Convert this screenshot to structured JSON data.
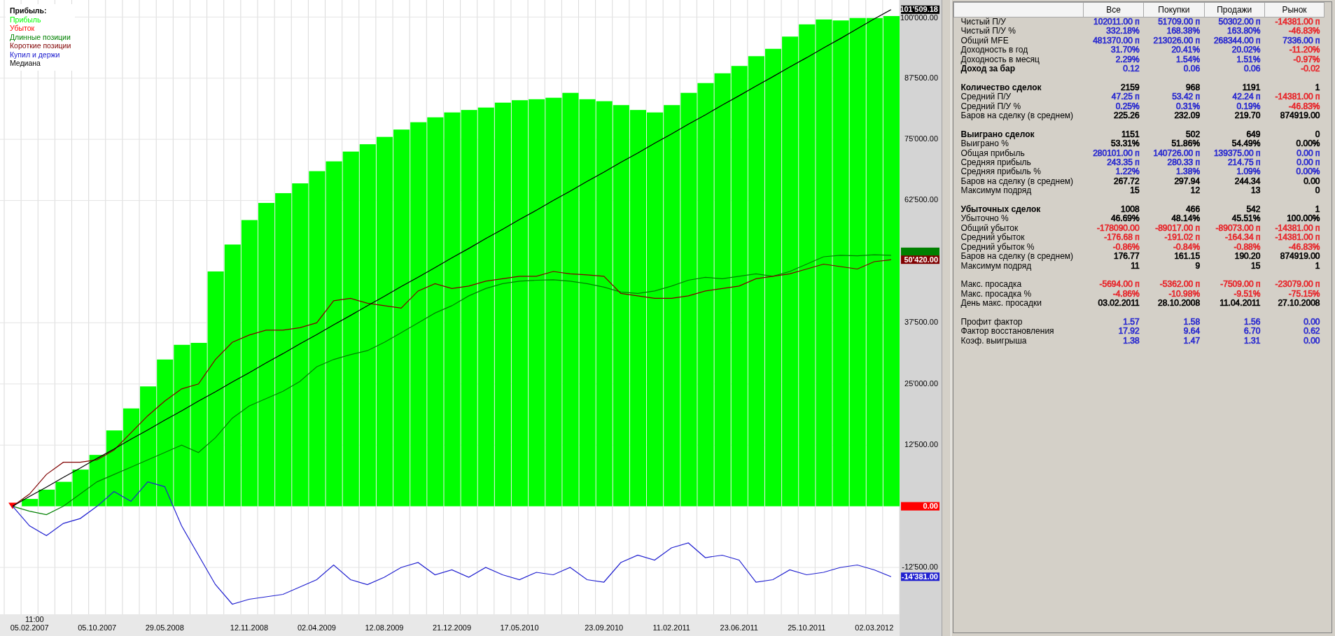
{
  "chart": {
    "time_label": "11:00",
    "chart_data": {
      "type": "bar",
      "title": "Прибыль:",
      "ylim": [
        -22080,
        103480
      ],
      "yticks": [
        {
          "value": -12500,
          "label": "-12'500.00"
        },
        {
          "value": 12500,
          "label": "12'500.00"
        },
        {
          "value": 25000,
          "label": "25'000.00"
        },
        {
          "value": 37500,
          "label": "37'500.00"
        },
        {
          "value": 62500,
          "label": "62'500.00"
        },
        {
          "value": 75000,
          "label": "75'000.00"
        },
        {
          "value": 87500,
          "label": "87'500.00"
        },
        {
          "value": 100000,
          "label": "100'000.00"
        }
      ],
      "grid": true,
      "categories": [
        null,
        "05.02.2007",
        null,
        null,
        null,
        "05.10.2007",
        null,
        null,
        null,
        "29.05.2008",
        null,
        null,
        null,
        null,
        "12.11.2008",
        null,
        null,
        null,
        "02.04.2009",
        null,
        null,
        null,
        "12.08.2009",
        null,
        null,
        null,
        "21.12.2009",
        null,
        null,
        null,
        "17.05.2010",
        null,
        null,
        null,
        null,
        "23.09.2010",
        null,
        null,
        null,
        "11.02.2011",
        null,
        null,
        null,
        "23.06.2011",
        null,
        null,
        null,
        "25.10.2011",
        null,
        null,
        null,
        "02.03.2012",
        null
      ],
      "series": [
        {
          "name": "Прибыль",
          "type": "bar",
          "color": "#00ff00",
          "values": [
            0,
            1500,
            3400,
            5000,
            7500,
            10500,
            15500,
            20000,
            24500,
            30000,
            33000,
            33400,
            48000,
            53500,
            58500,
            62000,
            64000,
            66000,
            68500,
            70500,
            72500,
            74000,
            75500,
            77000,
            78500,
            79500,
            80500,
            81000,
            81500,
            82500,
            83000,
            83200,
            83500,
            84500,
            83200,
            82800,
            82000,
            81000,
            80500,
            82000,
            84500,
            86500,
            88500,
            90000,
            92000,
            93500,
            96000,
            98500,
            99500,
            99300,
            99800,
            99800,
            100200
          ]
        },
        {
          "name": "Убыток",
          "type": "line",
          "color": "#ff0000",
          "marker": "triangle",
          "values": [
            0,
            null,
            null,
            null,
            null,
            null,
            null,
            null,
            null,
            null,
            null,
            null,
            null,
            null,
            null,
            null,
            null,
            null,
            null,
            null,
            null,
            null,
            null,
            null,
            null,
            null,
            null,
            null,
            null,
            null,
            null,
            null,
            null,
            null,
            null,
            null,
            null,
            null,
            null,
            null,
            null,
            null,
            null,
            null,
            null,
            null,
            null,
            null,
            null,
            null,
            null,
            null,
            null
          ]
        },
        {
          "name": "Длинные позиции",
          "type": "line",
          "color": "#008000",
          "values": [
            0,
            -1000,
            -1700,
            0,
            2500,
            5000,
            6500,
            8000,
            9500,
            11000,
            12500,
            11000,
            14000,
            18000,
            20500,
            22000,
            23500,
            25500,
            28500,
            30000,
            31000,
            31800,
            33500,
            35500,
            37500,
            39500,
            41000,
            43000,
            44500,
            45500,
            46000,
            46200,
            46300,
            46000,
            45500,
            44800,
            43800,
            43500,
            44000,
            45000,
            46200,
            46800,
            46500,
            47000,
            47500,
            47000,
            48000,
            49500,
            51000,
            51300,
            51200,
            51400,
            51300
          ]
        },
        {
          "name": "Короткие позиции",
          "type": "line",
          "color": "#800000",
          "values": [
            0,
            2500,
            6500,
            9000,
            9000,
            9500,
            11500,
            15000,
            18500,
            21500,
            24000,
            25000,
            30000,
            33500,
            35000,
            36000,
            36000,
            36500,
            37500,
            42000,
            42500,
            41500,
            41000,
            40500,
            44000,
            45500,
            44500,
            45000,
            46000,
            46500,
            47000,
            47000,
            48000,
            47500,
            47300,
            47000,
            43500,
            43000,
            42500,
            42500,
            43000,
            44000,
            44500,
            45000,
            46500,
            47000,
            47500,
            48500,
            49500,
            49000,
            48500,
            50000,
            50400
          ]
        },
        {
          "name": "Купил и держи",
          "type": "line",
          "color": "#2020d0",
          "values": [
            0,
            -4000,
            -6000,
            -3500,
            -2500,
            0,
            3000,
            1000,
            5000,
            4000,
            -4000,
            -10000,
            -16000,
            -20000,
            -19000,
            -18500,
            -18000,
            -16500,
            -15000,
            -12000,
            -15000,
            -16000,
            -14500,
            -12500,
            -11500,
            -14000,
            -13000,
            -14500,
            -12500,
            -14000,
            -15000,
            -13500,
            -14000,
            -12500,
            -15000,
            -15500,
            -11500,
            -10000,
            -11000,
            -8500,
            -7500,
            -10500,
            -10000,
            -11000,
            -15500,
            -15000,
            -13000,
            -14000,
            -13500,
            -12500,
            -12000,
            -13000,
            -14400
          ]
        },
        {
          "name": "Медиана",
          "type": "line",
          "color": "#000000",
          "values": [
            0,
            2000,
            3900,
            5900,
            7800,
            9800,
            11700,
            13700,
            15600,
            17600,
            19500,
            21500,
            23400,
            25400,
            27300,
            29300,
            31200,
            33200,
            35100,
            37100,
            39000,
            41000,
            42900,
            44900,
            46800,
            48800,
            50800,
            52700,
            54700,
            56600,
            58600,
            60500,
            62500,
            64400,
            66400,
            68300,
            70300,
            72200,
            74200,
            76100,
            78100,
            80000,
            82000,
            83900,
            85900,
            87800,
            89800,
            91700,
            93700,
            95600,
            97600,
            99600,
            101500
          ]
        }
      ]
    },
    "value_tags": [
      {
        "text": "101'509.18",
        "color": "#000000"
      },
      {
        "color": "#008000"
      },
      {
        "text": "50'420.00",
        "color": "#800000"
      },
      {
        "text": "0.00",
        "color": "#ff0000"
      },
      {
        "text": "-14'381.00",
        "color": "#2020d0"
      }
    ]
  },
  "table": {
    "columns": [
      "Все",
      "Покупки",
      "Продажи",
      "Рынок"
    ],
    "sections": [
      {
        "rows": [
          {
            "label": "Чистый П/У",
            "bold": false,
            "cells": [
              {
                "text": "102011.00 п",
                "color": "#2a2ad0"
              },
              {
                "text": "51709.00 п",
                "color": "#2a2ad0"
              },
              {
                "text": "50302.00 п",
                "color": "#2a2ad0"
              },
              {
                "text": "-14381.00 п",
                "color": "#e8262b"
              }
            ]
          },
          {
            "label": "Чистый П/У %",
            "bold": false,
            "cells": [
              {
                "text": "332.18%",
                "color": "#2a2ad0"
              },
              {
                "text": "168.38%",
                "color": "#2a2ad0"
              },
              {
                "text": "163.80%",
                "color": "#2a2ad0"
              },
              {
                "text": "-46.83%",
                "color": "#e8262b"
              }
            ]
          },
          {
            "label": "Общий MFE",
            "bold": false,
            "cells": [
              {
                "text": "481370.00 п",
                "color": "#2a2ad0"
              },
              {
                "text": "213026.00 п",
                "color": "#2a2ad0"
              },
              {
                "text": "268344.00 п",
                "color": "#2a2ad0"
              },
              {
                "text": "7336.00 п",
                "color": "#2a2ad0"
              }
            ]
          },
          {
            "label": "Доходность в год",
            "bold": false,
            "cells": [
              {
                "text": "31.70%",
                "color": "#2a2ad0"
              },
              {
                "text": "20.41%",
                "color": "#2a2ad0"
              },
              {
                "text": "20.02%",
                "color": "#2a2ad0"
              },
              {
                "text": "-11.20%",
                "color": "#e8262b"
              }
            ]
          },
          {
            "label": "Доходность в месяц",
            "bold": false,
            "cells": [
              {
                "text": "2.29%",
                "color": "#2a2ad0"
              },
              {
                "text": "1.54%",
                "color": "#2a2ad0"
              },
              {
                "text": "1.51%",
                "color": "#2a2ad0"
              },
              {
                "text": "-0.97%",
                "color": "#e8262b"
              }
            ]
          },
          {
            "label": "Доход за бар",
            "bold": true,
            "cells": [
              {
                "text": "0.12",
                "color": "#2a2ad0"
              },
              {
                "text": "0.06",
                "color": "#2a2ad0"
              },
              {
                "text": "0.06",
                "color": "#2a2ad0"
              },
              {
                "text": "-0.02",
                "color": "#e8262b"
              }
            ]
          }
        ]
      },
      {
        "rows": [
          {
            "label": "Количество сделок",
            "bold": true,
            "cells": [
              {
                "text": "2159",
                "color": "#000000"
              },
              {
                "text": "968",
                "color": "#000000"
              },
              {
                "text": "1191",
                "color": "#000000"
              },
              {
                "text": "1",
                "color": "#000000"
              }
            ]
          },
          {
            "label": "Средний П/У",
            "bold": false,
            "cells": [
              {
                "text": "47.25 п",
                "color": "#2a2ad0"
              },
              {
                "text": "53.42 п",
                "color": "#2a2ad0"
              },
              {
                "text": "42.24 п",
                "color": "#2a2ad0"
              },
              {
                "text": "-14381.00 п",
                "color": "#e8262b"
              }
            ]
          },
          {
            "label": "Средний П/У %",
            "bold": false,
            "cells": [
              {
                "text": "0.25%",
                "color": "#2a2ad0"
              },
              {
                "text": "0.31%",
                "color": "#2a2ad0"
              },
              {
                "text": "0.19%",
                "color": "#2a2ad0"
              },
              {
                "text": "-46.83%",
                "color": "#e8262b"
              }
            ]
          },
          {
            "label": "Баров на сделку (в среднем)",
            "bold": false,
            "cells": [
              {
                "text": "225.26",
                "color": "#000000"
              },
              {
                "text": "232.09",
                "color": "#000000"
              },
              {
                "text": "219.70",
                "color": "#000000"
              },
              {
                "text": "874919.00",
                "color": "#000000"
              }
            ]
          }
        ]
      },
      {
        "rows": [
          {
            "label": "Выиграно сделок",
            "bold": true,
            "cells": [
              {
                "text": "1151",
                "color": "#000000"
              },
              {
                "text": "502",
                "color": "#000000"
              },
              {
                "text": "649",
                "color": "#000000"
              },
              {
                "text": "0",
                "color": "#000000"
              }
            ]
          },
          {
            "label": "Выиграно %",
            "bold": false,
            "cells": [
              {
                "text": "53.31%",
                "color": "#000000"
              },
              {
                "text": "51.86%",
                "color": "#000000"
              },
              {
                "text": "54.49%",
                "color": "#000000"
              },
              {
                "text": "0.00%",
                "color": "#000000"
              }
            ]
          },
          {
            "label": "Общая прибыль",
            "bold": false,
            "cells": [
              {
                "text": "280101.00 п",
                "color": "#2a2ad0"
              },
              {
                "text": "140726.00 п",
                "color": "#2a2ad0"
              },
              {
                "text": "139375.00 п",
                "color": "#2a2ad0"
              },
              {
                "text": "0.00 п",
                "color": "#2a2ad0"
              }
            ]
          },
          {
            "label": "Средняя прибыль",
            "bold": false,
            "cells": [
              {
                "text": "243.35 п",
                "color": "#2a2ad0"
              },
              {
                "text": "280.33 п",
                "color": "#2a2ad0"
              },
              {
                "text": "214.75 п",
                "color": "#2a2ad0"
              },
              {
                "text": "0.00 п",
                "color": "#2a2ad0"
              }
            ]
          },
          {
            "label": "Средняя прибыль %",
            "bold": false,
            "cells": [
              {
                "text": "1.22%",
                "color": "#2a2ad0"
              },
              {
                "text": "1.38%",
                "color": "#2a2ad0"
              },
              {
                "text": "1.09%",
                "color": "#2a2ad0"
              },
              {
                "text": "0.00%",
                "color": "#2a2ad0"
              }
            ]
          },
          {
            "label": "Баров на сделку (в среднем)",
            "bold": false,
            "cells": [
              {
                "text": "267.72",
                "color": "#000000"
              },
              {
                "text": "297.94",
                "color": "#000000"
              },
              {
                "text": "244.34",
                "color": "#000000"
              },
              {
                "text": "0.00",
                "color": "#000000"
              }
            ]
          },
          {
            "label": "Максимум подряд",
            "bold": false,
            "cells": [
              {
                "text": "15",
                "color": "#000000"
              },
              {
                "text": "12",
                "color": "#000000"
              },
              {
                "text": "13",
                "color": "#000000"
              },
              {
                "text": "0",
                "color": "#000000"
              }
            ]
          }
        ]
      },
      {
        "rows": [
          {
            "label": "Убыточных сделок",
            "bold": true,
            "cells": [
              {
                "text": "1008",
                "color": "#000000"
              },
              {
                "text": "466",
                "color": "#000000"
              },
              {
                "text": "542",
                "color": "#000000"
              },
              {
                "text": "1",
                "color": "#000000"
              }
            ]
          },
          {
            "label": "Убыточно %",
            "bold": false,
            "cells": [
              {
                "text": "46.69%",
                "color": "#000000"
              },
              {
                "text": "48.14%",
                "color": "#000000"
              },
              {
                "text": "45.51%",
                "color": "#000000"
              },
              {
                "text": "100.00%",
                "color": "#000000"
              }
            ]
          },
          {
            "label": "Общий убыток",
            "bold": false,
            "cells": [
              {
                "text": "-178090.00",
                "color": "#e8262b"
              },
              {
                "text": "-89017.00 п",
                "color": "#e8262b"
              },
              {
                "text": "-89073.00 п",
                "color": "#e8262b"
              },
              {
                "text": "-14381.00 п",
                "color": "#e8262b"
              }
            ]
          },
          {
            "label": "Средний убыток",
            "bold": false,
            "cells": [
              {
                "text": "-176.68 п",
                "color": "#e8262b"
              },
              {
                "text": "-191.02 п",
                "color": "#e8262b"
              },
              {
                "text": "-164.34 п",
                "color": "#e8262b"
              },
              {
                "text": "-14381.00 п",
                "color": "#e8262b"
              }
            ]
          },
          {
            "label": "Средний убыток %",
            "bold": false,
            "cells": [
              {
                "text": "-0.86%",
                "color": "#e8262b"
              },
              {
                "text": "-0.84%",
                "color": "#e8262b"
              },
              {
                "text": "-0.88%",
                "color": "#e8262b"
              },
              {
                "text": "-46.83%",
                "color": "#e8262b"
              }
            ]
          },
          {
            "label": "Баров на сделку (в среднем)",
            "bold": false,
            "cells": [
              {
                "text": "176.77",
                "color": "#000000"
              },
              {
                "text": "161.15",
                "color": "#000000"
              },
              {
                "text": "190.20",
                "color": "#000000"
              },
              {
                "text": "874919.00",
                "color": "#000000"
              }
            ]
          },
          {
            "label": "Максимум подряд",
            "bold": false,
            "cells": [
              {
                "text": "11",
                "color": "#000000"
              },
              {
                "text": "9",
                "color": "#000000"
              },
              {
                "text": "15",
                "color": "#000000"
              },
              {
                "text": "1",
                "color": "#000000"
              }
            ]
          }
        ]
      },
      {
        "rows": [
          {
            "label": "Макс. просадка",
            "bold": false,
            "cells": [
              {
                "text": "-5694.00 п",
                "color": "#e8262b"
              },
              {
                "text": "-5362.00 п",
                "color": "#e8262b"
              },
              {
                "text": "-7509.00 п",
                "color": "#e8262b"
              },
              {
                "text": "-23079.00 п",
                "color": "#e8262b"
              }
            ]
          },
          {
            "label": "Макс. просадка %",
            "bold": false,
            "cells": [
              {
                "text": "-4.86%",
                "color": "#e8262b"
              },
              {
                "text": "-10.98%",
                "color": "#e8262b"
              },
              {
                "text": "-9.51%",
                "color": "#e8262b"
              },
              {
                "text": "-75.15%",
                "color": "#e8262b"
              }
            ]
          },
          {
            "label": "День макс. просадки",
            "bold": false,
            "cells": [
              {
                "text": "03.02.2011",
                "color": "#000000"
              },
              {
                "text": "28.10.2008",
                "color": "#000000"
              },
              {
                "text": "11.04.2011",
                "color": "#000000"
              },
              {
                "text": "27.10.2008",
                "color": "#000000"
              }
            ]
          }
        ]
      },
      {
        "rows": [
          {
            "label": "Профит фактор",
            "bold": false,
            "cells": [
              {
                "text": "1.57",
                "color": "#2a2ad0"
              },
              {
                "text": "1.58",
                "color": "#2a2ad0"
              },
              {
                "text": "1.56",
                "color": "#2a2ad0"
              },
              {
                "text": "0.00",
                "color": "#2a2ad0"
              }
            ]
          },
          {
            "label": "Фактор восстановления",
            "bold": false,
            "cells": [
              {
                "text": "17.92",
                "color": "#2a2ad0"
              },
              {
                "text": "9.64",
                "color": "#2a2ad0"
              },
              {
                "text": "6.70",
                "color": "#2a2ad0"
              },
              {
                "text": "0.62",
                "color": "#2a2ad0"
              }
            ]
          },
          {
            "label": "Коэф. выигрыша",
            "bold": false,
            "cells": [
              {
                "text": "1.38",
                "color": "#2a2ad0"
              },
              {
                "text": "1.47",
                "color": "#2a2ad0"
              },
              {
                "text": "1.31",
                "color": "#2a2ad0"
              },
              {
                "text": "0.00",
                "color": "#2a2ad0"
              }
            ]
          }
        ]
      }
    ]
  }
}
